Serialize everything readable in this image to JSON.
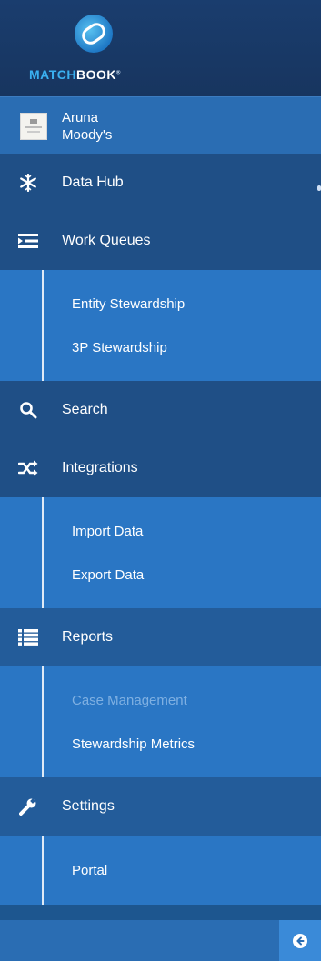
{
  "brand": {
    "part1": "MATCH",
    "part2": "BOOK",
    "tm": "®"
  },
  "user": {
    "name": "Aruna",
    "org": "Moody's"
  },
  "nav": {
    "data_hub": {
      "label": "Data Hub"
    },
    "work_queues": {
      "label": "Work Queues",
      "items": [
        {
          "label": "Entity Stewardship"
        },
        {
          "label": "3P Stewardship"
        }
      ]
    },
    "search": {
      "label": "Search"
    },
    "integrations": {
      "label": "Integrations",
      "items": [
        {
          "label": "Import Data"
        },
        {
          "label": "Export Data"
        }
      ]
    },
    "reports": {
      "label": "Reports",
      "items": [
        {
          "label": "Case Management",
          "disabled": true
        },
        {
          "label": "Stewardship Metrics"
        }
      ]
    },
    "settings": {
      "label": "Settings",
      "items": [
        {
          "label": "Portal"
        }
      ]
    }
  },
  "icons": {
    "data_hub": "snowflake-icon",
    "work_queues": "list-indent-icon",
    "search": "search-icon",
    "integrations": "shuffle-icon",
    "reports": "list-icon",
    "settings": "wrench-icon",
    "collapse": "arrow-left-circle-icon"
  },
  "colors": {
    "sidebar_bg": "#1d568f",
    "header_bg": "#1a3d6e",
    "submenu_bg": "#2a76c4",
    "accent": "#3ab0f0"
  }
}
